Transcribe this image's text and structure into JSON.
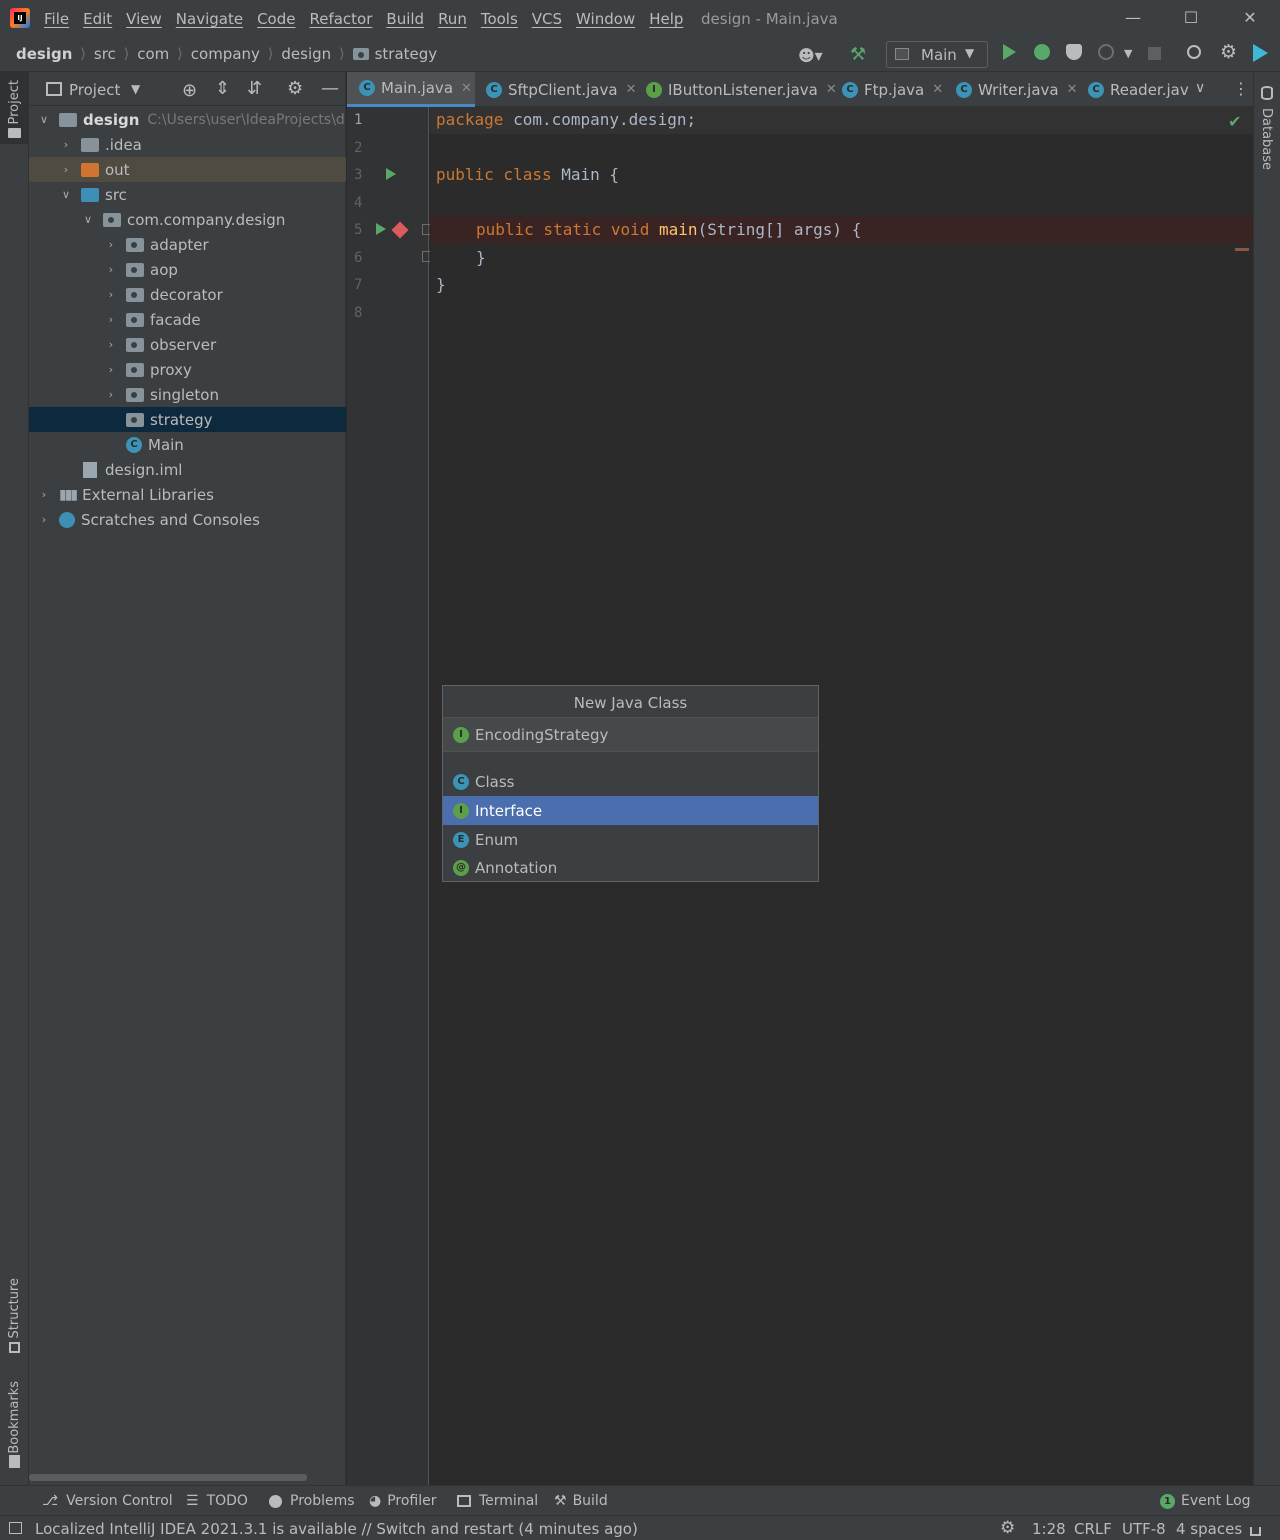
{
  "window": {
    "title": "design - Main.java",
    "menu": [
      "File",
      "Edit",
      "View",
      "Navigate",
      "Code",
      "Refactor",
      "Build",
      "Run",
      "Tools",
      "VCS",
      "Window",
      "Help"
    ]
  },
  "breadcrumb": [
    "design",
    "src",
    "com",
    "company",
    "design",
    "strategy"
  ],
  "run_config": "Main",
  "project_panel": {
    "title": "Project",
    "root": {
      "name": "design",
      "path": "C:\\Users\\user\\IdeaProjects\\d"
    },
    "items": [
      {
        "label": ".idea"
      },
      {
        "label": "out"
      },
      {
        "label": "src"
      },
      {
        "label": "com.company.design"
      },
      {
        "label": "adapter"
      },
      {
        "label": "aop"
      },
      {
        "label": "decorator"
      },
      {
        "label": "facade"
      },
      {
        "label": "observer"
      },
      {
        "label": "proxy"
      },
      {
        "label": "singleton"
      },
      {
        "label": "strategy"
      },
      {
        "label": "Main"
      },
      {
        "label": "design.iml"
      },
      {
        "label": "External Libraries"
      },
      {
        "label": "Scratches and Consoles"
      }
    ]
  },
  "left_strip": {
    "project": "Project",
    "structure": "Structure",
    "bookmarks": "Bookmarks"
  },
  "right_strip": {
    "database": "Database"
  },
  "tabs": [
    {
      "label": "Main.java",
      "icon": "C"
    },
    {
      "label": "SftpClient.java",
      "icon": "C"
    },
    {
      "label": "IButtonListener.java",
      "icon": "I"
    },
    {
      "label": "Ftp.java",
      "icon": "C"
    },
    {
      "label": "Writer.java",
      "icon": "C"
    },
    {
      "label": "Reader.jav",
      "icon": "C"
    }
  ],
  "editor": {
    "line_numbers": [
      "1",
      "2",
      "3",
      "4",
      "5",
      "6",
      "7",
      "8"
    ],
    "code": {
      "l1_kw": "package",
      "l1_rest": " com.company.design;",
      "l3_kw": "public class",
      "l3_rest": " Main {",
      "l5_kw": "public static void",
      "l5_fn": "main",
      "l5_rest": "(String[] args) {",
      "l6": "}",
      "l7": "}"
    }
  },
  "popup": {
    "title": "New Java Class",
    "input_value": "EncodingStrategy",
    "options": [
      {
        "label": "Class",
        "badge": "C"
      },
      {
        "label": "Interface",
        "badge": "I"
      },
      {
        "label": "Enum",
        "badge": "E"
      },
      {
        "label": "Annotation",
        "badge": "@"
      }
    ],
    "selected": "Interface"
  },
  "bottom_tools": [
    "Version Control",
    "TODO",
    "Problems",
    "Profiler",
    "Terminal",
    "Build"
  ],
  "event_log": {
    "count": "1",
    "label": "Event Log"
  },
  "status": {
    "message": "Localized IntelliJ IDEA 2021.3.1 is available // Switch and restart (4 minutes ago)",
    "position": "1:28",
    "line_sep": "CRLF",
    "encoding": "UTF-8",
    "indent": "4 spaces"
  },
  "colors": {
    "accent": "#4b6eaf",
    "keyword": "#cc7832",
    "function": "#ffc66d",
    "selection": "#0d293e"
  }
}
